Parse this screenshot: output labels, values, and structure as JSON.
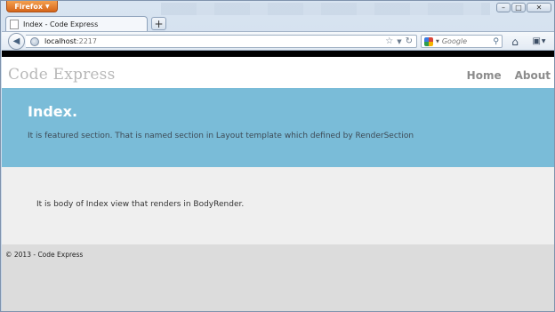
{
  "browser": {
    "menu_button_label": "Firefox",
    "tab_title": "Index - Code Express",
    "new_tab_label": "+",
    "url_host": "localhost",
    "url_port": ":2217",
    "search_placeholder": "Google"
  },
  "site": {
    "title": "Code Express",
    "nav": [
      {
        "label": "Home"
      },
      {
        "label": "About"
      }
    ]
  },
  "featured": {
    "heading": "Index.",
    "text": "It is featured section. That is named section in Layout template which defined by RenderSection"
  },
  "body": {
    "text": "It is body of Index view that renders in BodyRender."
  },
  "footer": {
    "text": "© 2013 - Code Express"
  },
  "colors": {
    "featured_bg": "#7abcd8",
    "body_bg": "#efefef",
    "footer_bg": "#dcdcdc",
    "firefox_orange": "#e07828"
  }
}
